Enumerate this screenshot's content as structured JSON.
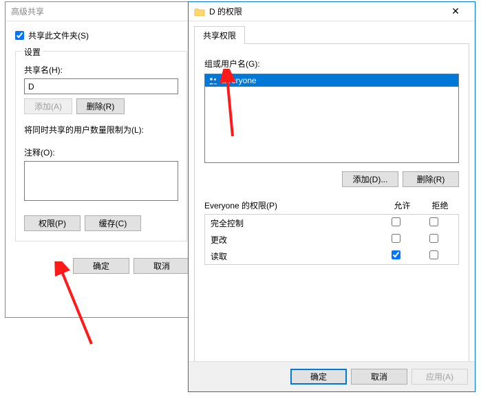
{
  "advWindow": {
    "title": "高级共享",
    "shareCheckbox": "共享此文件夹(S)",
    "shareChecked": true,
    "settingsLegend": "设置",
    "shareNameLabel": "共享名(H):",
    "shareNameValue": "D",
    "addBtn": "添加(A)",
    "removeBtn": "删除(R)",
    "limitLabel": "将同时共享的用户数量限制为(L):",
    "commentLabel": "注释(O):",
    "permBtn": "权限(P)",
    "cacheBtn": "缓存(C)",
    "ok": "确定",
    "cancel": "取消"
  },
  "permWindow": {
    "title": "D 的权限",
    "tab": "共享权限",
    "groupLabel": "组或用户名(G):",
    "users": [
      {
        "name": "Everyone",
        "selected": true
      }
    ],
    "addBtn": "添加(D)...",
    "removeBtn": "删除(R)",
    "permForLabel": "Everyone 的权限(P)",
    "allowCol": "允许",
    "denyCol": "拒绝",
    "rows": [
      {
        "label": "完全控制",
        "allow": false,
        "deny": false
      },
      {
        "label": "更改",
        "allow": false,
        "deny": false
      },
      {
        "label": "读取",
        "allow": true,
        "deny": false
      }
    ],
    "ok": "确定",
    "cancel": "取消",
    "apply": "应用(A)"
  }
}
